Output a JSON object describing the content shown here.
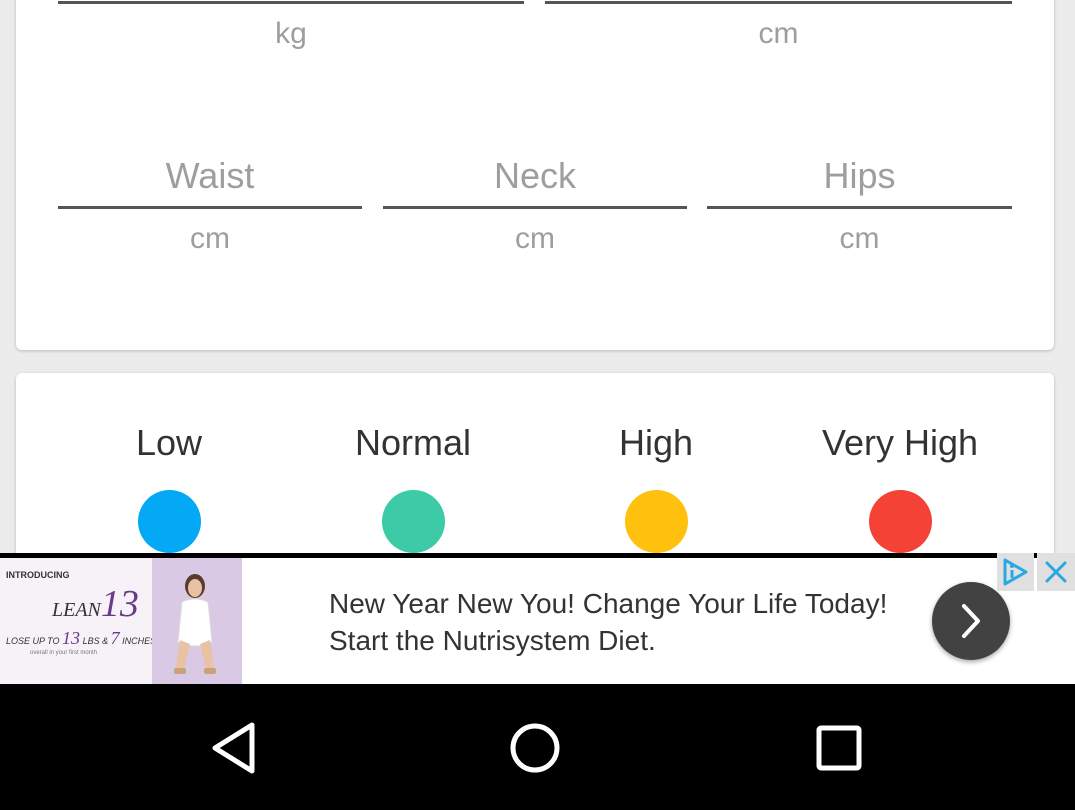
{
  "measurements": {
    "top_row_units": [
      "kg",
      "cm"
    ],
    "fields": [
      {
        "placeholder": "Waist",
        "unit": "cm"
      },
      {
        "placeholder": "Neck",
        "unit": "cm"
      },
      {
        "placeholder": "Hips",
        "unit": "cm"
      }
    ]
  },
  "legend": {
    "items": [
      {
        "label": "Low",
        "color": "#03a9f4"
      },
      {
        "label": "Normal",
        "color": "#3dcaa7"
      },
      {
        "label": "High",
        "color": "#ffc10e"
      },
      {
        "label": "Very High",
        "color": "#f44336"
      }
    ]
  },
  "ad": {
    "headline": "New Year New You! Change Your Life Today! Start the Nutrisystem Diet.",
    "image_intro": "INTRODUCING",
    "image_brand": "LEAN",
    "image_brand_number": "13",
    "image_tagline_prefix": "LOSE UP TO",
    "image_tagline_lbs_num": "13",
    "image_tagline_lbs": "LBS &",
    "image_tagline_inches_num": "7",
    "image_tagline_inches": "INCHES",
    "image_fine_print": "overall in your first month",
    "icons": {
      "next": "chevron-right-icon",
      "adchoices": "adchoices-icon",
      "close": "close-icon"
    }
  },
  "navbar": {
    "icons": [
      "back-triangle-icon",
      "home-circle-icon",
      "recents-square-icon"
    ]
  }
}
